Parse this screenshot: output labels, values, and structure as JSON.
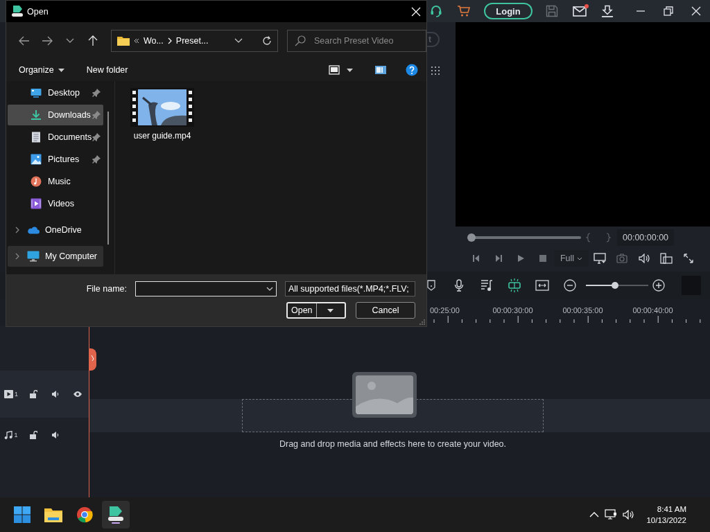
{
  "dialog": {
    "title": "Open",
    "path": [
      "Wo...",
      "Preset..."
    ],
    "search": {
      "placeholder": "Search Preset Video"
    },
    "commands": [
      "Organize",
      "New folder"
    ],
    "nav": [
      {
        "label": "Desktop",
        "pinned": true,
        "expandable": false,
        "selected": false,
        "focused": false
      },
      {
        "label": "Downloads",
        "pinned": true,
        "expandable": false,
        "selected": true,
        "focused": false
      },
      {
        "label": "Documents",
        "pinned": true,
        "expandable": false,
        "selected": false,
        "focused": false
      },
      {
        "label": "Pictures",
        "pinned": true,
        "expandable": false,
        "selected": false,
        "focused": false
      },
      {
        "label": "Music",
        "pinned": false,
        "expandable": false,
        "selected": false,
        "focused": false
      },
      {
        "label": "Videos",
        "pinned": false,
        "expandable": false,
        "selected": false,
        "focused": false
      },
      {
        "label": "OneDrive",
        "pinned": false,
        "expandable": true,
        "selected": false,
        "focused": false
      },
      {
        "label": "My Computer",
        "pinned": false,
        "expandable": true,
        "selected": false,
        "focused": true
      }
    ],
    "files": [
      {
        "name": "user guide.mp4",
        "kind": "picture"
      }
    ],
    "file_name": {
      "label": "File name:"
    },
    "file_type": "All supported files(*.MP4;*.FLV;",
    "buttons": [
      "Open",
      "Cancel"
    ]
  },
  "editor": {
    "top_bar": {
      "login": "Login",
      "notification": true
    },
    "side_button": "t",
    "preview": {
      "progress": {
        "level": 0
      },
      "timecode": "00:00:00:00",
      "quality": "Full"
    },
    "zoom": {
      "level": 0.47
    },
    "ruler": [
      "00:25:00",
      "00:00:30:00",
      "00:00:35:00",
      "00:00:40:00"
    ],
    "tracks": [
      {
        "kind": "video",
        "number": "1"
      },
      {
        "kind": "audio",
        "number": "1"
      }
    ],
    "drop_hint": "Drag and drop media and effects here to create your video."
  },
  "taskbar": {
    "time": "8:41 AM",
    "date": "10/13/2022"
  }
}
